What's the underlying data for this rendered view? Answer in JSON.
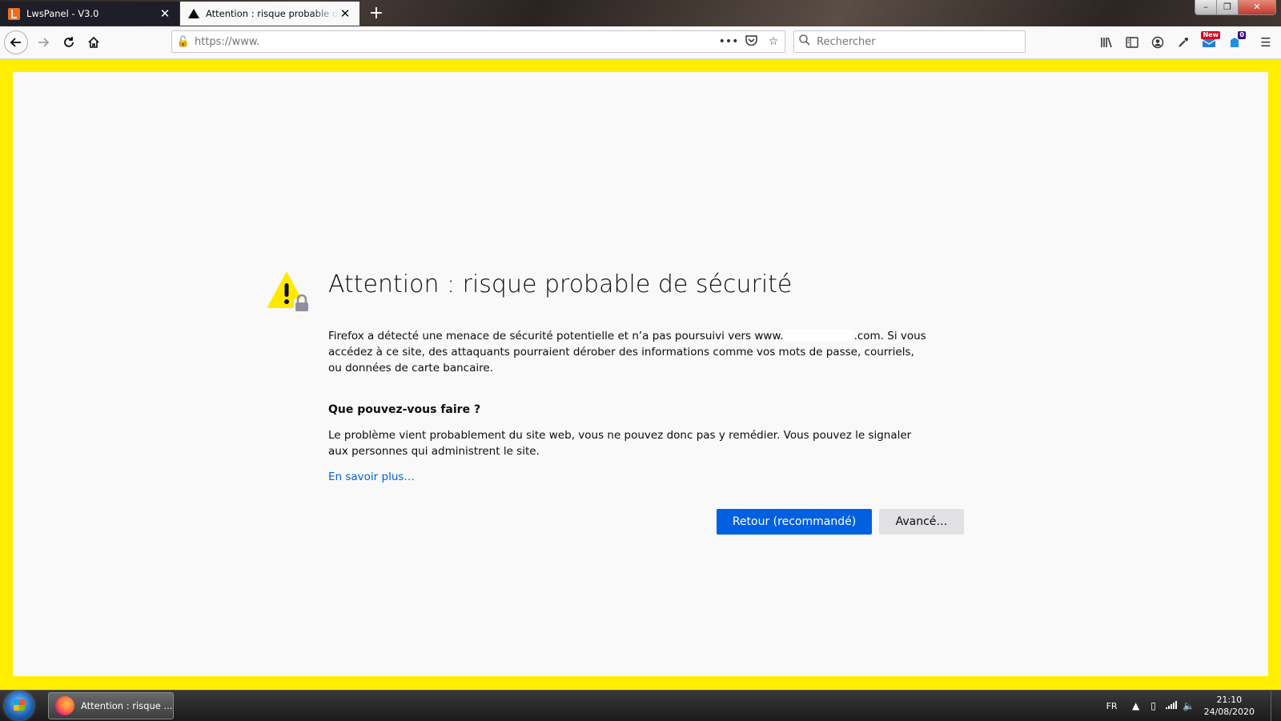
{
  "tabs": [
    {
      "title": "LwsPanel - V3.0",
      "icon": "lws-icon",
      "active": false
    },
    {
      "title": "Attention : risque probable de sécurité",
      "icon": "warning-icon",
      "active": true
    }
  ],
  "window_controls": {
    "minimize": "–",
    "maximize": "❐",
    "close": "✕"
  },
  "navbar": {
    "url": "https://www.",
    "search_placeholder": "Rechercher",
    "badges": {
      "new": "New",
      "count": "0"
    }
  },
  "error_page": {
    "title": "Attention : risque probable de sécurité",
    "p1_before": "Firefox a détecté une menace de sécurité potentielle et n’a pas poursuivi vers www.",
    "p1_after": ".com. Si vous accédez à ce site, des attaquants pourraient dérober des informations comme vos mots de passe, courriels, ou données de carte bancaire.",
    "what_heading": "Que pouvez-vous faire ?",
    "what_text": "Le problème vient probablement du site web, vous ne pouvez donc pas y remédier. Vous pouvez le signaler aux personnes qui administrent le site.",
    "learn_more": "En savoir plus…",
    "back_button": "Retour (recommandé)",
    "advanced_button": "Avancé…"
  },
  "taskbar": {
    "task_title": "Attention : risque ...",
    "language": "FR",
    "time": "21:10",
    "date": "24/08/2020"
  },
  "colors": {
    "highlight": "#ffee00",
    "primary_button": "#0060df",
    "link": "#0060df",
    "warning": "#ffe900"
  }
}
